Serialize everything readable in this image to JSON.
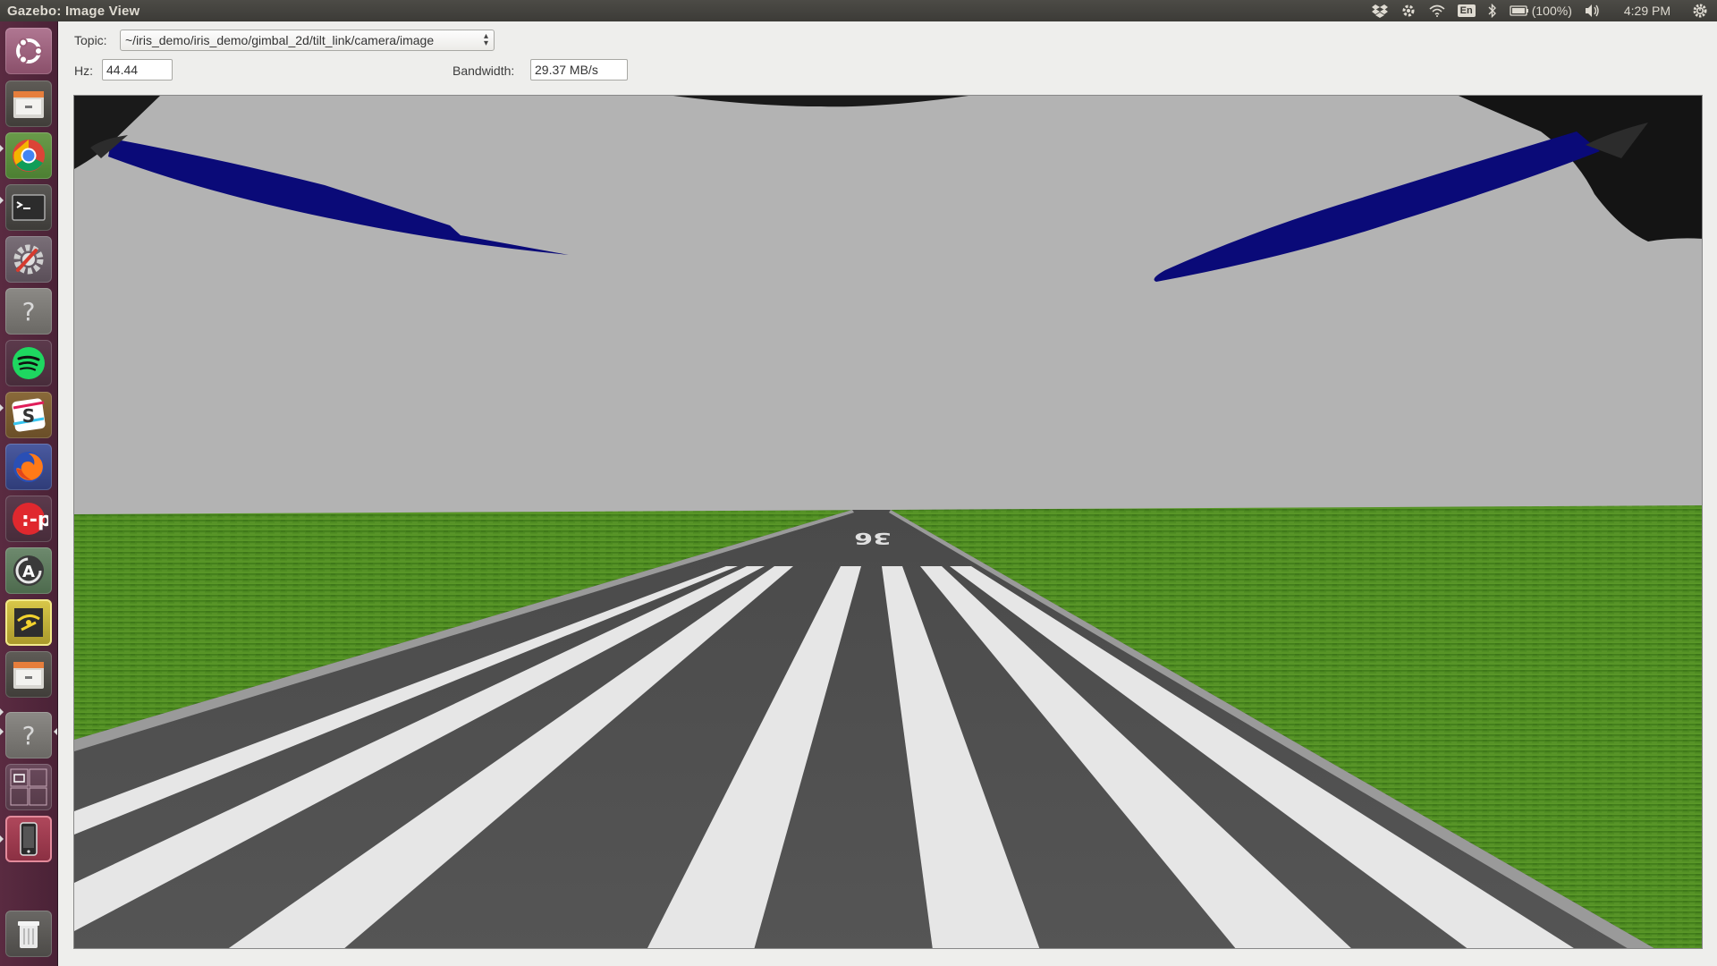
{
  "window": {
    "title": "Gazebo: Image View"
  },
  "panel": {
    "language": "En",
    "battery": "(100%)",
    "clock": "4:29 PM"
  },
  "toolbar": {
    "topic_label": "Topic:",
    "topic_value": "~/iris_demo/iris_demo/gimbal_2d/tilt_link/camera/image",
    "hz_label": "Hz:",
    "hz_value": "44.44",
    "bandwidth_label": "Bandwidth:",
    "bandwidth_value": "29.37 MB/s"
  },
  "scene": {
    "runway_marking": "36",
    "sky_color": "#b3b3b3",
    "grass_color": "#4f8a1e",
    "propeller_color": "#0a0a78",
    "runway_color": "#505050",
    "stripe_color": "#e6e6e6"
  },
  "launcher": {
    "items": [
      {
        "icon": "ubuntu-dash-icon"
      },
      {
        "icon": "files-icon"
      },
      {
        "icon": "chrome-icon"
      },
      {
        "icon": "terminal-icon"
      },
      {
        "icon": "system-settings-icon"
      },
      {
        "icon": "unknown-app-icon"
      },
      {
        "icon": "spotify-icon"
      },
      {
        "icon": "slack-icon"
      },
      {
        "icon": "firefox-icon"
      },
      {
        "icon": "pomodoro-icon"
      },
      {
        "icon": "software-updater-icon"
      },
      {
        "icon": "gazebo-icon"
      },
      {
        "icon": "files-icon-2"
      },
      {
        "icon": "unknown-app-icon-2"
      },
      {
        "icon": "workspace-switcher-icon"
      },
      {
        "icon": "device-icon"
      },
      {
        "icon": "trash-icon"
      }
    ]
  }
}
